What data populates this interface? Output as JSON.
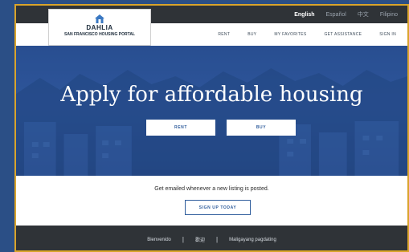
{
  "languages": [
    "English",
    "Español",
    "中文",
    "Filipino"
  ],
  "active_language": "English",
  "logo": {
    "name": "DAHLIA",
    "subtitle": "SAN FRANCISCO HOUSING PORTAL"
  },
  "nav": [
    "RENT",
    "BUY",
    "MY FAVORITES",
    "GET ASSISTANCE",
    "SIGN IN"
  ],
  "hero": {
    "title": "Apply for affordable housing",
    "rent_label": "RENT",
    "buy_label": "BUY"
  },
  "signup": {
    "text": "Get emailed whenever a new listing is posted.",
    "button": "SIGN UP TODAY"
  },
  "footer": {
    "links": [
      "Bienvenido",
      "歡迎",
      "Maligayang pagdating"
    ],
    "separator": "|"
  },
  "colors": {
    "hero_blue": "#2e5699",
    "accent": "#2f5d9c",
    "dark_bar": "#2f3337",
    "frame_border": "#d9a42b",
    "page_bg": "#2b4f86"
  }
}
